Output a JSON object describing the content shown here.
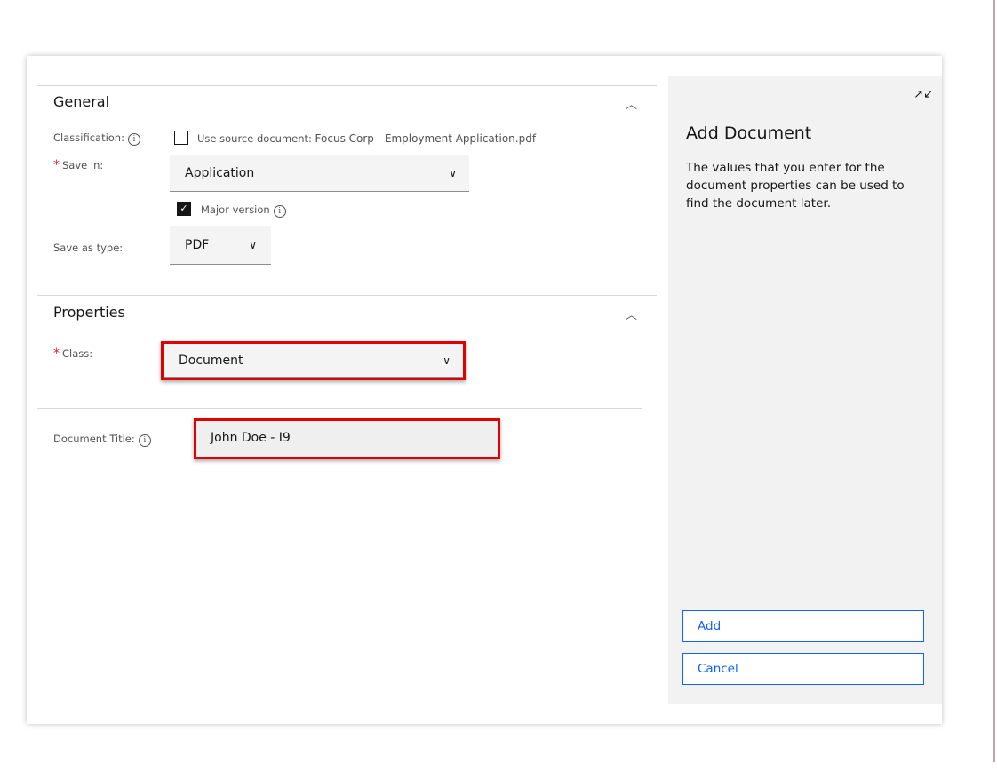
{
  "general": {
    "title": "General",
    "classification_label": "Classification:",
    "use_source_label": "Use source document:",
    "source_filename": "Focus Corp - Employment Application.pdf",
    "save_in_label": "Save in:",
    "save_in_value": "Application",
    "major_version_label": "Major version",
    "save_as_type_label": "Save as type:",
    "save_as_type_value": "PDF"
  },
  "properties": {
    "title": "Properties",
    "class_label": "Class:",
    "class_value": "Document",
    "doc_title_label": "Document Title:",
    "doc_title_value": "John Doe - I9"
  },
  "panel": {
    "title": "Add Document",
    "description": "The values that you enter for the document properties can be used to find the document later.",
    "add_label": "Add",
    "cancel_label": "Cancel"
  },
  "glyphs": {
    "chevron_up": "︿",
    "chevron_down": "∨",
    "info": "i",
    "check": "✓",
    "required": "*",
    "collapse": "↗↙"
  },
  "colors": {
    "accent": "#0f62fe",
    "highlight": "#e00000",
    "required": "#da1e28",
    "panel_bg": "#f2f2f2"
  }
}
